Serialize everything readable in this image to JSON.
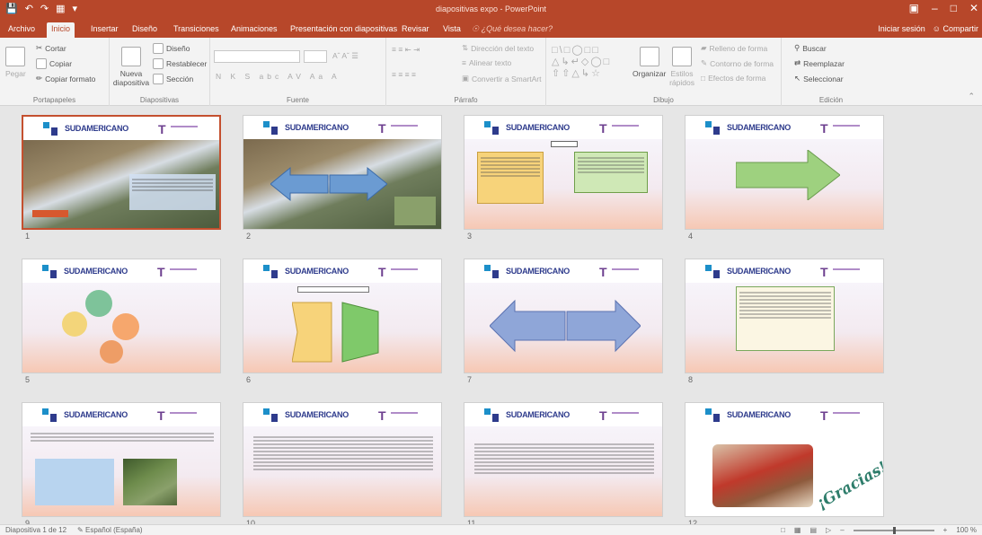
{
  "titlebar": {
    "title": "diapositivas expo - PowerPoint"
  },
  "tabs": [
    {
      "label": "Archivo"
    },
    {
      "label": "Inicio"
    },
    {
      "label": "Insertar"
    },
    {
      "label": "Diseño"
    },
    {
      "label": "Transiciones"
    },
    {
      "label": "Animaciones"
    },
    {
      "label": "Presentación con diapositivas"
    },
    {
      "label": "Revisar"
    },
    {
      "label": "Vista"
    },
    {
      "label": "¿Qué desea hacer?"
    }
  ],
  "account": {
    "signin": "Iniciar sesión",
    "share": "Compartir"
  },
  "ribbon": {
    "clipboard": {
      "paste": "Pegar",
      "cut": "Cortar",
      "copy": "Copiar",
      "format_painter": "Copiar formato",
      "label": "Portapapeles"
    },
    "slides": {
      "new_slide": "Nueva diapositiva",
      "layout": "Diseño",
      "reset": "Restablecer",
      "section": "Sección",
      "label": "Diapositivas"
    },
    "font": {
      "label": "Fuente"
    },
    "paragraph": {
      "text_direction": "Dirección del texto",
      "align_text": "Alinear texto",
      "smartart": "Convertir a SmartArt",
      "label": "Párrafo"
    },
    "drawing": {
      "arrange": "Organizar",
      "quick_styles": "Estilos rápidos",
      "shape_fill": "Relleno de forma",
      "shape_outline": "Contorno de forma",
      "shape_effects": "Efectos de forma",
      "label": "Dibujo"
    },
    "editing": {
      "find": "Buscar",
      "replace": "Reemplazar",
      "select": "Seleccionar",
      "label": "Edición"
    }
  },
  "slides": [
    {
      "number": "1",
      "logo": "SUDAMERICANO"
    },
    {
      "number": "2",
      "logo": "SUDAMERICANO"
    },
    {
      "number": "3",
      "logo": "SUDAMERICANO"
    },
    {
      "number": "4",
      "logo": "SUDAMERICANO"
    },
    {
      "number": "5",
      "logo": "SUDAMERICANO"
    },
    {
      "number": "6",
      "logo": "SUDAMERICANO"
    },
    {
      "number": "7",
      "logo": "SUDAMERICANO"
    },
    {
      "number": "8",
      "logo": "SUDAMERICANO"
    },
    {
      "number": "9",
      "logo": "SUDAMERICANO"
    },
    {
      "number": "10",
      "logo": "SUDAMERICANO"
    },
    {
      "number": "11",
      "logo": "SUDAMERICANO"
    },
    {
      "number": "12",
      "logo": "SUDAMERICANO",
      "caption": "¡Gracias!"
    }
  ],
  "status": {
    "slide_info": "Diapositiva 1 de 12",
    "language": "Español (España)",
    "zoom": "100 %"
  },
  "colors": {
    "accent": "#b7472a",
    "selected_border": "#c4502f"
  }
}
